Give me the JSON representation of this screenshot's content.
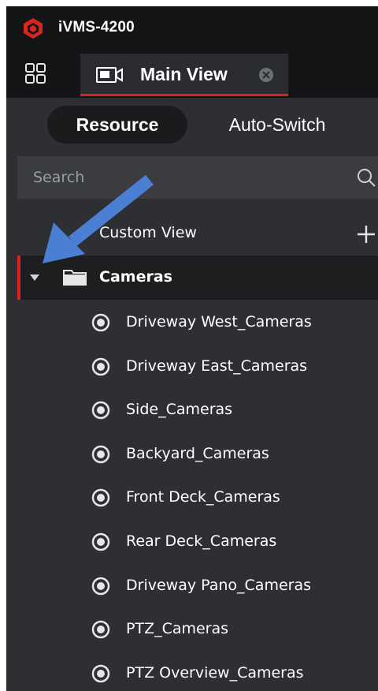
{
  "app": {
    "title": "iVMS-4200",
    "accent_color": "#e02020"
  },
  "tabs": [
    {
      "label": "Main View",
      "icon": "camera-view-icon",
      "active": true
    }
  ],
  "resource_switch": {
    "options": [
      "Resource",
      "Auto-Switch"
    ],
    "selected": "Resource"
  },
  "search": {
    "placeholder": "Search",
    "value": ""
  },
  "custom_view": {
    "label": "Custom View"
  },
  "group": {
    "label": "Cameras",
    "expanded": true,
    "icon": "folder-icon"
  },
  "cameras": [
    {
      "label": "Driveway West_Cameras"
    },
    {
      "label": "Driveway East_Cameras"
    },
    {
      "label": "Side_Cameras"
    },
    {
      "label": "Backyard_Cameras"
    },
    {
      "label": "Front Deck_Cameras"
    },
    {
      "label": "Rear Deck_Cameras"
    },
    {
      "label": "Driveway Pano_Cameras"
    },
    {
      "label": "PTZ_Cameras"
    },
    {
      "label": "PTZ Overview_Cameras"
    }
  ],
  "annotation": {
    "type": "arrow",
    "color": "#4a7fd4"
  }
}
